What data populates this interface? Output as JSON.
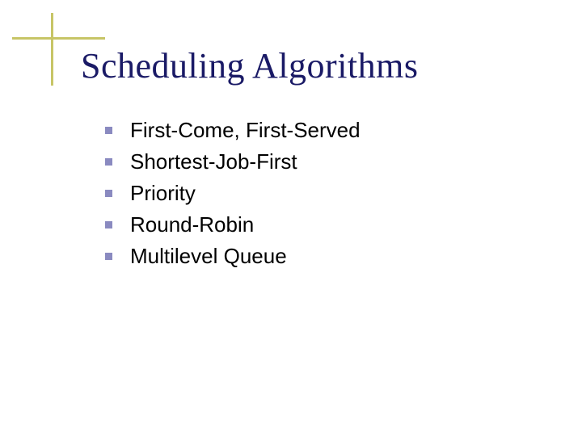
{
  "slide": {
    "title": "Scheduling Algorithms",
    "items": [
      "First-Come, First-Served",
      "Shortest-Job-First",
      "Priority",
      "Round-Robin",
      "Multilevel Queue"
    ]
  },
  "colors": {
    "title": "#1a1a66",
    "bullet": "#8a8ac0",
    "decoration": "#c7c566",
    "text": "#000000"
  }
}
